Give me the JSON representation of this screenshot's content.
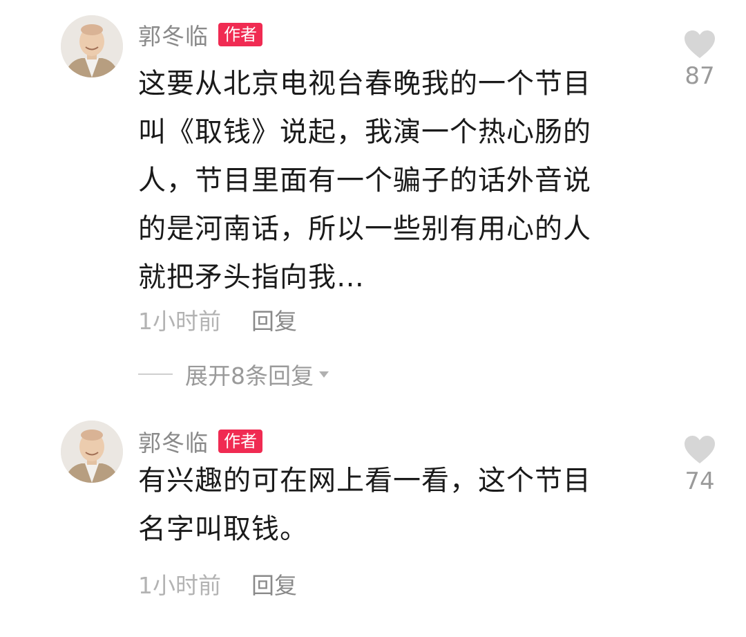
{
  "comments": [
    {
      "username": "郭冬临",
      "badge": "作者",
      "text": "这要从北京电视台春晚我的一个节目叫《取钱》说起，我演一个热心肠的人，节目里面有一个骗子的话外音说的是河南话，所以一些别有用心的人就把矛头指向我…",
      "text_lines": [
        "这要从北京电视台春晚我的一个节目",
        "叫《取钱》说起，我演一个热心肠的",
        "人，节目里面有一个骗子的话外音说",
        "的是河南话，所以一些别有用心的人",
        "就把矛头指向我…"
      ],
      "timestamp": "1小时前",
      "reply_label": "回复",
      "likes": "87",
      "expand_label": "展开8条回复"
    },
    {
      "username": "郭冬临",
      "badge": "作者",
      "text": "有兴趣的可在网上看一看，这个节目名字叫取钱。",
      "text_lines": [
        "有兴趣的可在网上看一看，这个节目",
        "名字叫取钱。"
      ],
      "timestamp": "1小时前",
      "reply_label": "回复",
      "likes": "74"
    }
  ],
  "icons": {
    "like": "heart-icon",
    "expand": "caret-down-icon"
  },
  "colors": {
    "badge": "#f02b52",
    "text": "#1a1a1a",
    "secondary": "#8a8a8a",
    "heart": "#d6d6d6"
  }
}
